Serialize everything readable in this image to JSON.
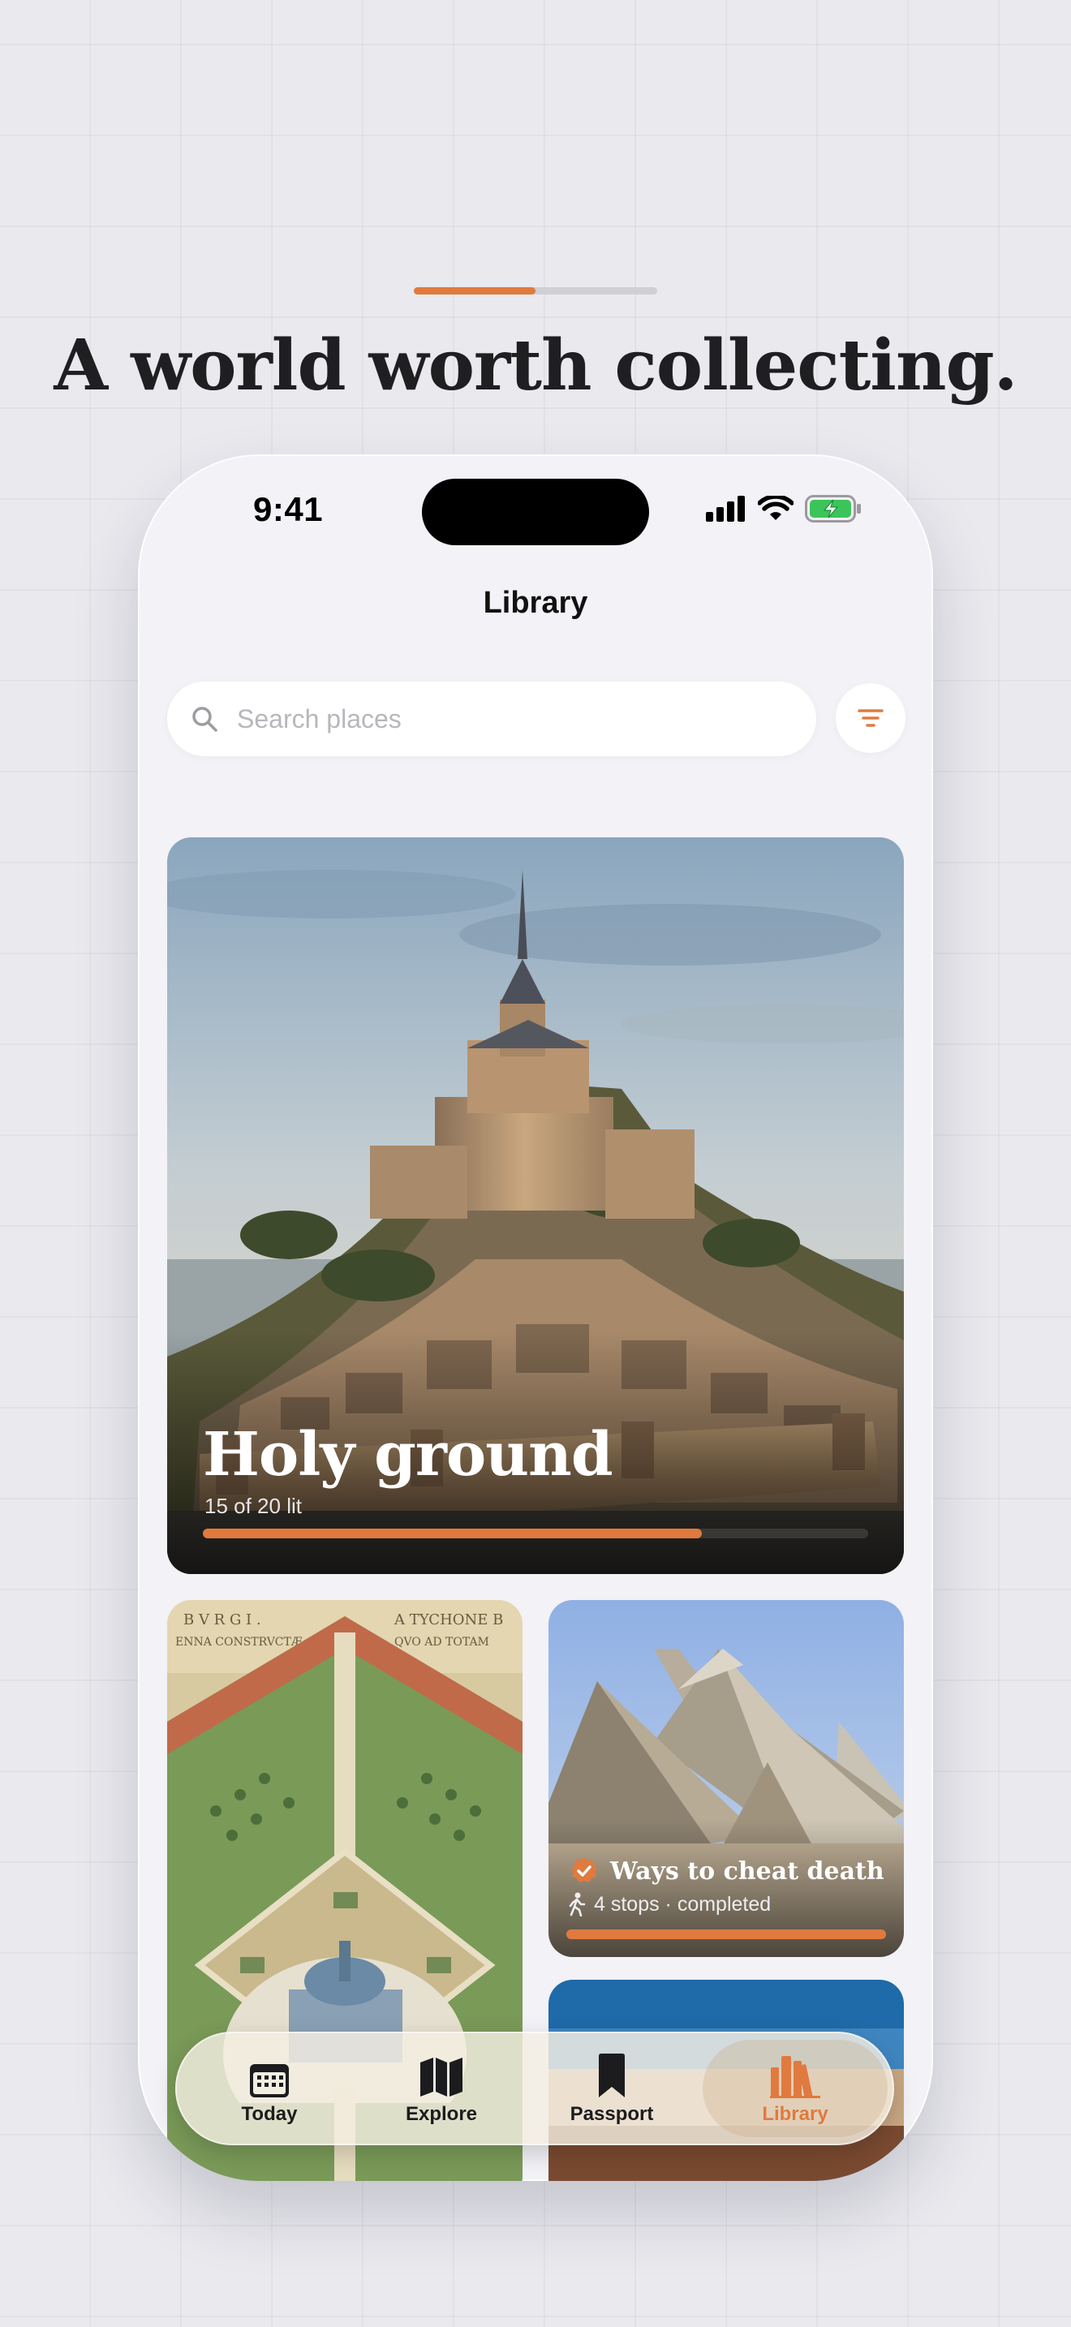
{
  "headline": "A world worth collecting.",
  "onboarding_progress": 0.5,
  "status_bar": {
    "time": "9:41"
  },
  "nav": {
    "title": "Library"
  },
  "search": {
    "placeholder": "Search places",
    "value": ""
  },
  "cards": [
    {
      "title": "Holy ground",
      "subtitle": "15 of 20 lit",
      "progress": 0.75
    },
    {
      "title": "Ways to cheat death",
      "subtitle": "4 stops · completed",
      "progress": 1.0,
      "status": "completed"
    }
  ],
  "tabs": [
    {
      "label": "Today",
      "icon": "calendar-icon",
      "active": false
    },
    {
      "label": "Explore",
      "icon": "map-icon",
      "active": false
    },
    {
      "label": "Passport",
      "icon": "bookmark-icon",
      "active": false
    },
    {
      "label": "Library",
      "icon": "books-icon",
      "active": true
    }
  ],
  "colors": {
    "accent": "#e07a3f",
    "background": "#f2f2f7",
    "text": "#1c1c1e"
  }
}
